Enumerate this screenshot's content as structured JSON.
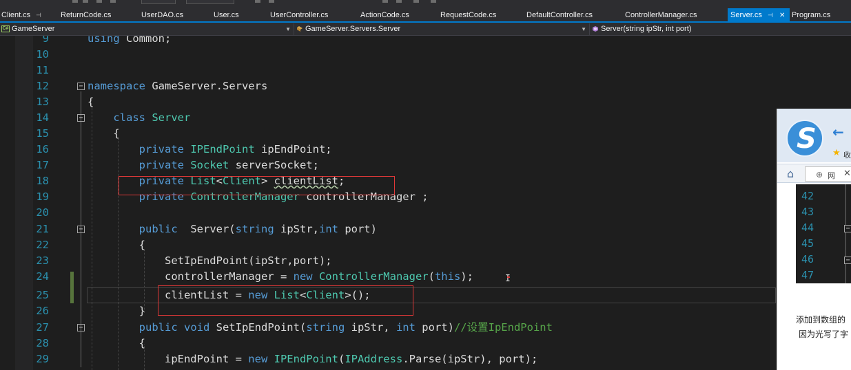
{
  "tabs": [
    {
      "label": "Client.cs",
      "pinned": true
    },
    {
      "label": "ReturnCode.cs"
    },
    {
      "label": "UserDAO.cs"
    },
    {
      "label": "User.cs"
    },
    {
      "label": "UserController.cs"
    },
    {
      "label": "ActionCode.cs"
    },
    {
      "label": "RequestCode.cs"
    },
    {
      "label": "DefaultController.cs"
    },
    {
      "label": "ControllerManager.cs"
    },
    {
      "label": "Server.cs",
      "active": true,
      "pinned": true,
      "closable": true
    },
    {
      "label": "Program.cs"
    }
  ],
  "navbar": {
    "project": "GameServer",
    "type": "GameServer.Servers.Server",
    "member": "Server(string ipStr, int port)"
  },
  "code_lines": [
    {
      "n": "9",
      "tokens": [
        [
          "kw",
          "using"
        ],
        [
          "p",
          " Common;"
        ]
      ]
    },
    {
      "n": "10",
      "tokens": []
    },
    {
      "n": "11",
      "tokens": []
    },
    {
      "n": "12",
      "tokens": [
        [
          "kw",
          "namespace"
        ],
        [
          "p",
          " GameServer.Servers"
        ]
      ]
    },
    {
      "n": "13",
      "tokens": [
        [
          "p",
          "{"
        ]
      ]
    },
    {
      "n": "14",
      "tokens": [
        [
          "p",
          "    "
        ],
        [
          "kw",
          "class"
        ],
        [
          "p",
          " "
        ],
        [
          "ty",
          "Server"
        ]
      ]
    },
    {
      "n": "15",
      "tokens": [
        [
          "p",
          "    {"
        ]
      ]
    },
    {
      "n": "16",
      "tokens": [
        [
          "p",
          "        "
        ],
        [
          "kw",
          "private"
        ],
        [
          "p",
          " "
        ],
        [
          "ty",
          "IPEndPoint"
        ],
        [
          "p",
          " ipEndPoint;"
        ]
      ]
    },
    {
      "n": "17",
      "tokens": [
        [
          "p",
          "        "
        ],
        [
          "kw",
          "private"
        ],
        [
          "p",
          " "
        ],
        [
          "ty",
          "Socket"
        ],
        [
          "p",
          " serverSocket;"
        ]
      ]
    },
    {
      "n": "18",
      "tokens": [
        [
          "p",
          "        "
        ],
        [
          "kw",
          "private"
        ],
        [
          "p",
          " "
        ],
        [
          "ty",
          "List"
        ],
        [
          "p",
          "<"
        ],
        [
          "ty",
          "Client"
        ],
        [
          "p",
          "> "
        ],
        [
          "sq",
          "clientList"
        ],
        [
          "p",
          ";"
        ]
      ]
    },
    {
      "n": "19",
      "tokens": [
        [
          "p",
          "        "
        ],
        [
          "kw",
          "private"
        ],
        [
          "p",
          " "
        ],
        [
          "ty",
          "ControllerManager"
        ],
        [
          "p",
          " controllerManager ;"
        ]
      ]
    },
    {
      "n": "20",
      "tokens": []
    },
    {
      "n": "21",
      "tokens": [
        [
          "p",
          "        "
        ],
        [
          "kw",
          "public"
        ],
        [
          "p",
          "  Server("
        ],
        [
          "kw",
          "string"
        ],
        [
          "p",
          " ipStr,"
        ],
        [
          "kw",
          "int"
        ],
        [
          "p",
          " port)"
        ]
      ]
    },
    {
      "n": "22",
      "tokens": [
        [
          "p",
          "        {"
        ]
      ]
    },
    {
      "n": "23",
      "tokens": [
        [
          "p",
          "            SetIpEndPoint(ipStr,port);"
        ]
      ]
    },
    {
      "n": "24",
      "tokens": [
        [
          "p",
          "            controllerManager = "
        ],
        [
          "kw",
          "new"
        ],
        [
          "p",
          " "
        ],
        [
          "ty",
          "ControllerManager"
        ],
        [
          "p",
          "("
        ],
        [
          "kw",
          "this"
        ],
        [
          "p",
          ");"
        ]
      ]
    },
    {
      "n": "25",
      "tokens": [
        [
          "p",
          "            clientList = "
        ],
        [
          "kw",
          "new"
        ],
        [
          "p",
          " "
        ],
        [
          "ty",
          "List"
        ],
        [
          "p",
          "<"
        ],
        [
          "ty",
          "Client"
        ],
        [
          "p",
          ">();"
        ]
      ]
    },
    {
      "n": "26",
      "tokens": [
        [
          "p",
          "        }"
        ]
      ]
    },
    {
      "n": "27",
      "tokens": [
        [
          "p",
          "        "
        ],
        [
          "kw",
          "public"
        ],
        [
          "p",
          " "
        ],
        [
          "kw",
          "void"
        ],
        [
          "p",
          " SetIpEndPoint("
        ],
        [
          "kw",
          "string"
        ],
        [
          "p",
          " ipStr, "
        ],
        [
          "kw",
          "int"
        ],
        [
          "p",
          " port)"
        ],
        [
          "cm",
          "//设置IpEndPoint"
        ]
      ]
    },
    {
      "n": "28",
      "tokens": [
        [
          "p",
          "        {"
        ]
      ]
    },
    {
      "n": "29",
      "tokens": [
        [
          "p",
          "            ipEndPoint = "
        ],
        [
          "kw",
          "new"
        ],
        [
          "p",
          " "
        ],
        [
          "ty",
          "IPEndPoint"
        ],
        [
          "p",
          "("
        ],
        [
          "ty",
          "IPAddress"
        ],
        [
          "p",
          ".Parse(ipStr), port);"
        ]
      ]
    }
  ],
  "browser": {
    "logo_letter": "S",
    "back_icon": "←",
    "fav_text": "收",
    "tab_text": "网",
    "tab_close": "✕",
    "side_line_numbers": [
      "42",
      "43",
      "44",
      "45",
      "46",
      "47"
    ],
    "text_line1": "添加到数组的",
    "text_line2": "因为光写了字"
  },
  "colors": {
    "keyword": "#569cd6",
    "type": "#4ec9b0",
    "comment": "#57a64a",
    "line_number": "#2b91af",
    "active_tab": "#007acc",
    "highlight_box": "#e03838"
  }
}
